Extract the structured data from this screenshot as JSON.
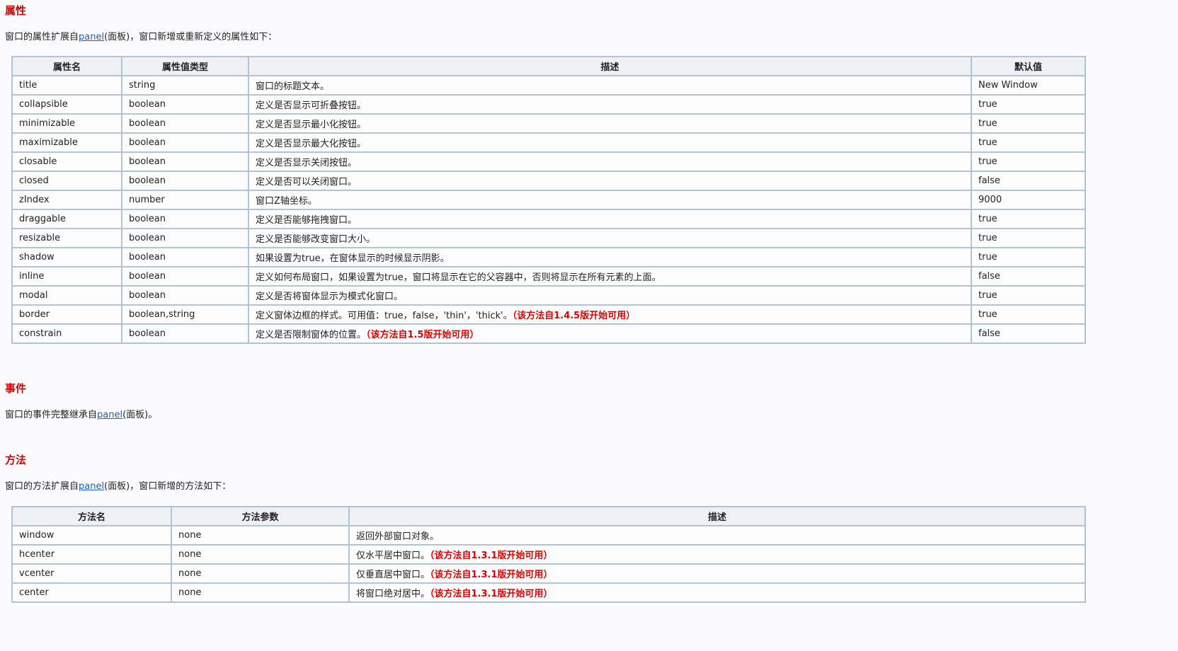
{
  "sections": {
    "properties": {
      "title": "属性",
      "intro_before": "窗口的属性扩展自",
      "intro_link": "panel",
      "intro_after": "(面板)，窗口新增或重新定义的属性如下：",
      "headers": [
        "属性名",
        "属性值类型",
        "描述",
        "默认值"
      ],
      "rows": [
        {
          "name": "title",
          "type": "string",
          "desc": "窗口的标题文本。",
          "note": "",
          "default": "New Window"
        },
        {
          "name": "collapsible",
          "type": "boolean",
          "desc": "定义是否显示可折叠按钮。",
          "note": "",
          "default": "true"
        },
        {
          "name": "minimizable",
          "type": "boolean",
          "desc": "定义是否显示最小化按钮。",
          "note": "",
          "default": "true"
        },
        {
          "name": "maximizable",
          "type": "boolean",
          "desc": "定义是否显示最大化按钮。",
          "note": "",
          "default": "true"
        },
        {
          "name": "closable",
          "type": "boolean",
          "desc": "定义是否显示关闭按钮。",
          "note": "",
          "default": "true"
        },
        {
          "name": "closed",
          "type": "boolean",
          "desc": "定义是否可以关闭窗口。",
          "note": "",
          "default": "false"
        },
        {
          "name": "zIndex",
          "type": "number",
          "desc": "窗口Z轴坐标。",
          "note": "",
          "default": "9000"
        },
        {
          "name": "draggable",
          "type": "boolean",
          "desc": "定义是否能够拖拽窗口。",
          "note": "",
          "default": "true"
        },
        {
          "name": "resizable",
          "type": "boolean",
          "desc": "定义是否能够改变窗口大小。",
          "note": "",
          "default": "true"
        },
        {
          "name": "shadow",
          "type": "boolean",
          "desc": "如果设置为true，在窗体显示的时候显示阴影。",
          "note": "",
          "default": "true"
        },
        {
          "name": "inline",
          "type": "boolean",
          "desc": "定义如何布局窗口，如果设置为true，窗口将显示在它的父容器中，否则将显示在所有元素的上面。",
          "note": "",
          "default": "false"
        },
        {
          "name": "modal",
          "type": "boolean",
          "desc": "定义是否将窗体显示为模式化窗口。",
          "note": "",
          "default": "true"
        },
        {
          "name": "border",
          "type": "boolean,string",
          "desc": "定义窗体边框的样式。可用值：true，false，'thin'，'thick'。",
          "note": "（该方法自1.4.5版开始可用）",
          "default": "true"
        },
        {
          "name": "constrain",
          "type": "boolean",
          "desc": "定义是否限制窗体的位置。",
          "note": "（该方法自1.5版开始可用）",
          "default": "false"
        }
      ]
    },
    "events": {
      "title": "事件",
      "intro_before": "窗口的事件完整继承自",
      "intro_link": "panel",
      "intro_after": "(面板)。"
    },
    "methods": {
      "title": "方法",
      "intro_before": "窗口的方法扩展自",
      "intro_link": "panel",
      "intro_after": "(面板)，窗口新增的方法如下：",
      "headers": [
        "方法名",
        "方法参数",
        "描述"
      ],
      "rows": [
        {
          "name": "window",
          "params": "none",
          "desc": "返回外部窗口对象。",
          "note": ""
        },
        {
          "name": "hcenter",
          "params": "none",
          "desc": "仅水平居中窗口。",
          "note": "（该方法自1.3.1版开始可用）"
        },
        {
          "name": "vcenter",
          "params": "none",
          "desc": "仅垂直居中窗口。",
          "note": "（该方法自1.3.1版开始可用）"
        },
        {
          "name": "center",
          "params": "none",
          "desc": "将窗口绝对居中。",
          "note": "（该方法自1.3.1版开始可用）"
        }
      ]
    }
  },
  "colors": {
    "heading": "#d40000",
    "note": "#e00000",
    "link": "#1a5fb4",
    "border": "#b2c3d3",
    "header_bg": "#eef0f3"
  }
}
